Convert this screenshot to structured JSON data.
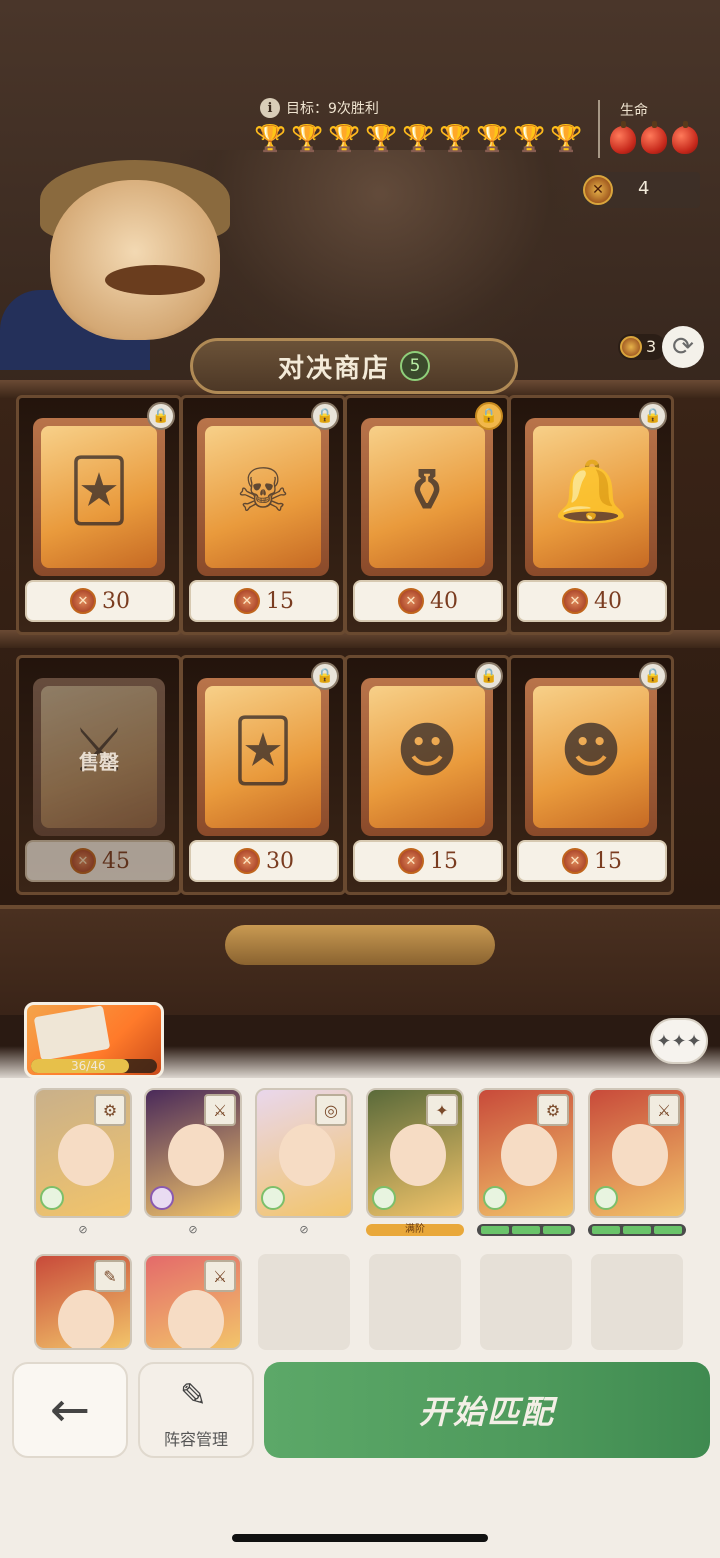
{
  "hud": {
    "goal_text": "目标：9次胜利",
    "trophies_won": 8,
    "trophies_total": 9,
    "hp_label": "生命",
    "lives": 3,
    "coins": "4"
  },
  "shop": {
    "title": "对决商店",
    "level": "5",
    "refresh_cost": "3",
    "items": [
      {
        "price": "30",
        "locked": true,
        "lock_style": "grey",
        "kind": "card-pack",
        "glyph": "🃏"
      },
      {
        "price": "15",
        "locked": true,
        "lock_style": "grey",
        "kind": "hero",
        "glyph": "☠"
      },
      {
        "price": "40",
        "locked": true,
        "lock_style": "gold",
        "kind": "item",
        "glyph": "⚱"
      },
      {
        "price": "40",
        "locked": true,
        "lock_style": "grey",
        "kind": "item",
        "glyph": "🔔"
      },
      {
        "price": "45",
        "locked": false,
        "sold": true,
        "sold_label": "售罄",
        "kind": "hero",
        "glyph": "⚔"
      },
      {
        "price": "30",
        "locked": true,
        "lock_style": "grey",
        "kind": "card-pack",
        "glyph": "🃏"
      },
      {
        "price": "15",
        "locked": true,
        "lock_style": "grey",
        "kind": "hero",
        "glyph": "☻"
      },
      {
        "price": "15",
        "locked": true,
        "lock_style": "grey",
        "kind": "hero",
        "glyph": "☻"
      }
    ]
  },
  "map": {
    "progress_text": "36/46",
    "progress_fraction": 0.78
  },
  "team": {
    "heroes": [
      {
        "status": "none",
        "item_glyph": "⚙",
        "bg": "#c9b08a",
        "faction": "green"
      },
      {
        "status": "none",
        "item_glyph": "⚔",
        "bg": "#4a2a5a",
        "faction": "purple"
      },
      {
        "status": "none",
        "item_glyph": "◎",
        "bg": "#e9d7ec",
        "faction": "green"
      },
      {
        "status": "max",
        "status_text": "满阶",
        "item_glyph": "✦",
        "bg": "#5a6a3a",
        "faction": "green"
      },
      {
        "status": "bars",
        "bars": 3,
        "item_glyph": "⚙",
        "bg": "#c84a3a",
        "faction": "green"
      },
      {
        "status": "bars",
        "bars": 3,
        "item_glyph": "⚔",
        "bg": "#c84a3a",
        "faction": "green"
      },
      {
        "status": "",
        "item_glyph": "✎",
        "bg": "#c84a3a",
        "faction": ""
      },
      {
        "status": "",
        "item_glyph": "⚔",
        "bg": "#e46a6a",
        "faction": ""
      }
    ],
    "empty_slots": 4
  },
  "buttons": {
    "back_glyph": "←",
    "team_manage": "阵容管理",
    "team_glyph": "✎",
    "start_match": "开始匹配"
  },
  "icons": {
    "info": "i",
    "trophy": "🏆",
    "refresh": "⟳",
    "chat": "✦✦✦"
  }
}
